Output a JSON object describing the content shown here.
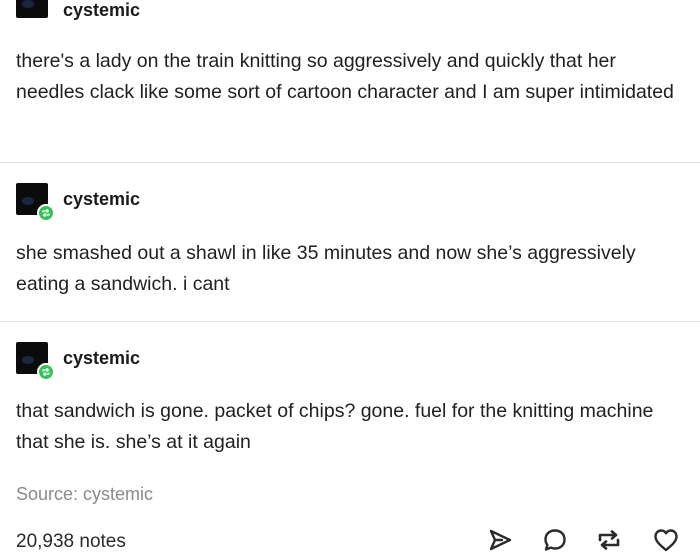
{
  "posts": [
    {
      "username": "cystemic",
      "text": "there's a lady on the train knitting so aggressively and quickly that her needles clack like some sort of cartoon character and I am super intimidated"
    },
    {
      "username": "cystemic",
      "text": "she smashed out a shawl in like 35 minutes and now she’s aggressively eating a sandwich. i cant"
    },
    {
      "username": "cystemic",
      "text": "that sandwich is gone. packet of chips? gone. fuel for the knitting machine that she is. she’s at it again"
    }
  ],
  "source": "Source: cystemic",
  "notes": "20,938 notes",
  "actions": {
    "share_icon": "paper-plane-icon",
    "reply_icon": "speech-bubble-icon",
    "reblog_icon": "reblog-icon",
    "like_icon": "heart-icon"
  },
  "colors": {
    "reblog_badge": "#36c15b",
    "text": "#1f1f1f",
    "muted": "#8a8a8a",
    "divider": "#e4e4e4"
  }
}
